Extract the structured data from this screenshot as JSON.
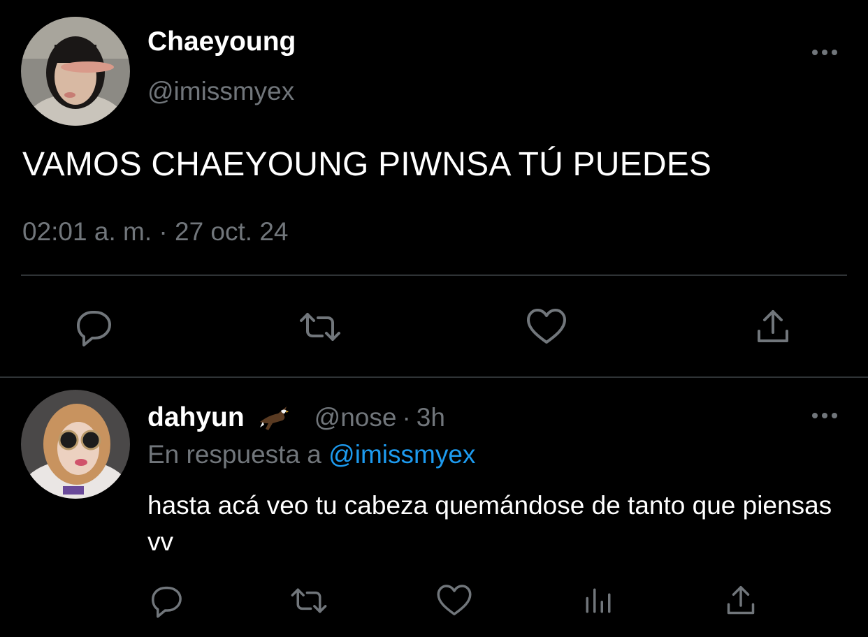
{
  "main_tweet": {
    "display_name": "Chaeyoung",
    "handle": "@imissmyex",
    "text": "VAMOS CHAEYOUNG PIWNSA TÚ PUEDES",
    "timestamp": "02:01 a. m. · 27 oct. 24",
    "more_icon": "more-horizontal-icon",
    "actions": [
      "reply-icon",
      "retweet-icon",
      "like-icon",
      "share-icon"
    ]
  },
  "reply_tweet": {
    "display_name": "dahyun",
    "emoji_icon": "eagle-emoji",
    "handle": "@nose",
    "separator": "·",
    "age": "3h",
    "reply_to_prefix": "En respuesta a",
    "reply_to_handle": "@imissmyex",
    "text": "hasta acá veo tu cabeza quemándose de tanto que piensas vv",
    "more_icon": "more-horizontal-icon",
    "actions": [
      "reply-icon",
      "retweet-icon",
      "like-icon",
      "views-icon",
      "share-icon"
    ]
  },
  "colors": {
    "background": "#000000",
    "primary_text": "#ffffff",
    "secondary_text": "#71767b",
    "link": "#1d9bf0",
    "divider": "#2f3336"
  }
}
